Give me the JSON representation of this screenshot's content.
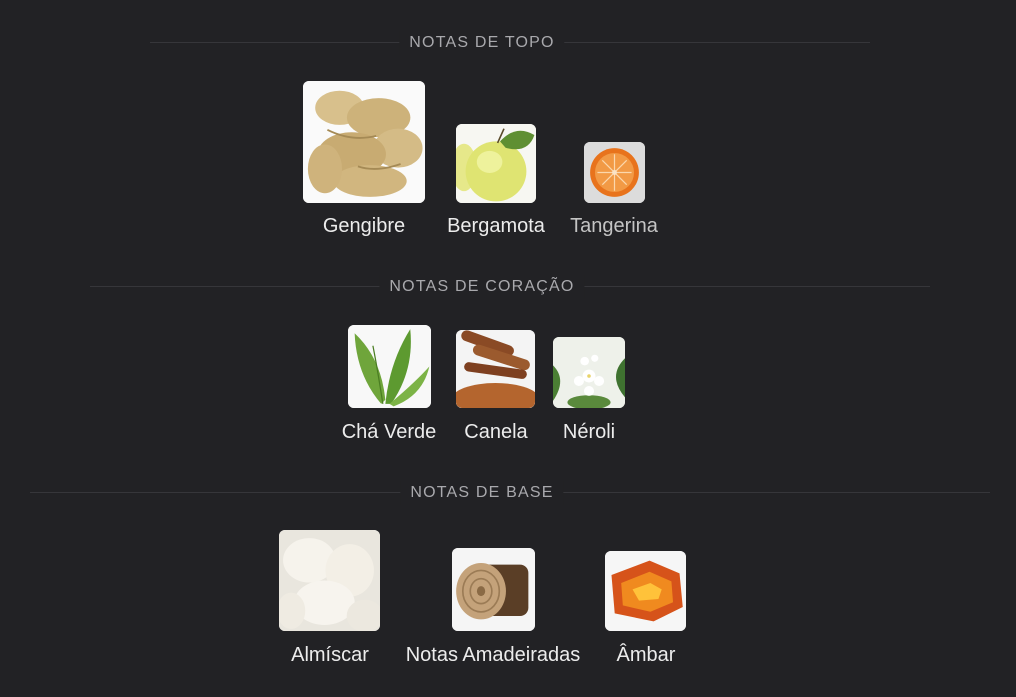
{
  "sections": [
    {
      "title": "NOTAS DE TOPO",
      "notes": [
        {
          "label": "Gengibre",
          "icon": "ginger-root-icon"
        },
        {
          "label": "Bergamota",
          "icon": "bergamot-fruit-icon"
        },
        {
          "label": "Tangerina",
          "icon": "tangerine-icon"
        }
      ]
    },
    {
      "title": "NOTAS DE CORAÇÃO",
      "notes": [
        {
          "label": "Chá Verde",
          "icon": "green-tea-leaves-icon"
        },
        {
          "label": "Canela",
          "icon": "cinnamon-icon"
        },
        {
          "label": "Néroli",
          "icon": "neroli-flower-icon"
        }
      ]
    },
    {
      "title": "NOTAS DE BASE",
      "notes": [
        {
          "label": "Almíscar",
          "icon": "musk-icon"
        },
        {
          "label": "Notas Amadeiradas",
          "icon": "wood-log-icon"
        },
        {
          "label": "Âmbar",
          "icon": "amber-icon"
        }
      ]
    }
  ],
  "colors": {
    "background": "#222225",
    "title": "#a9a9ad",
    "label": "#ececec"
  }
}
